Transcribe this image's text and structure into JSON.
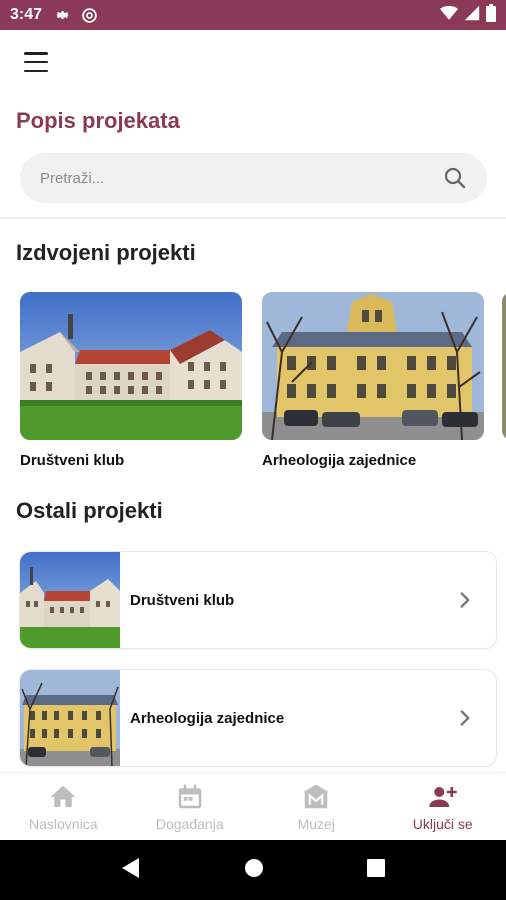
{
  "status_bar": {
    "time": "3:47",
    "icons": [
      "settings-icon",
      "at-sign-icon",
      "wifi-icon",
      "signal-icon",
      "battery-icon"
    ],
    "bg_color": "#8a3a57"
  },
  "app_bar": {
    "menu_icon": "hamburger-menu-icon"
  },
  "page": {
    "title": "Popis projekata"
  },
  "search": {
    "placeholder": "Pretraži...",
    "value": "",
    "icon": "search-icon"
  },
  "featured": {
    "title": "Izdvojeni projekti",
    "items": [
      {
        "label": "Društveni klub",
        "image": "manor-house-photo"
      },
      {
        "label": "Arheologija zajednice",
        "image": "yellow-building-photo"
      },
      {
        "label": "",
        "image": "partial-card-photo"
      }
    ]
  },
  "others": {
    "title": "Ostali projekti",
    "items": [
      {
        "label": "Društveni klub",
        "image": "manor-house-photo"
      },
      {
        "label": "Arheologija zajednice",
        "image": "yellow-building-photo"
      }
    ]
  },
  "bottom_nav": {
    "items": [
      {
        "label": "Naslovnica",
        "icon": "home-icon",
        "active": false
      },
      {
        "label": "Događanja",
        "icon": "calendar-icon",
        "active": false
      },
      {
        "label": "Muzej",
        "icon": "museum-icon",
        "active": false
      },
      {
        "label": "Uključi se",
        "icon": "add-person-icon",
        "active": true
      }
    ]
  },
  "colors": {
    "accent": "#8a3a57",
    "inactive": "#bdbdbd"
  }
}
